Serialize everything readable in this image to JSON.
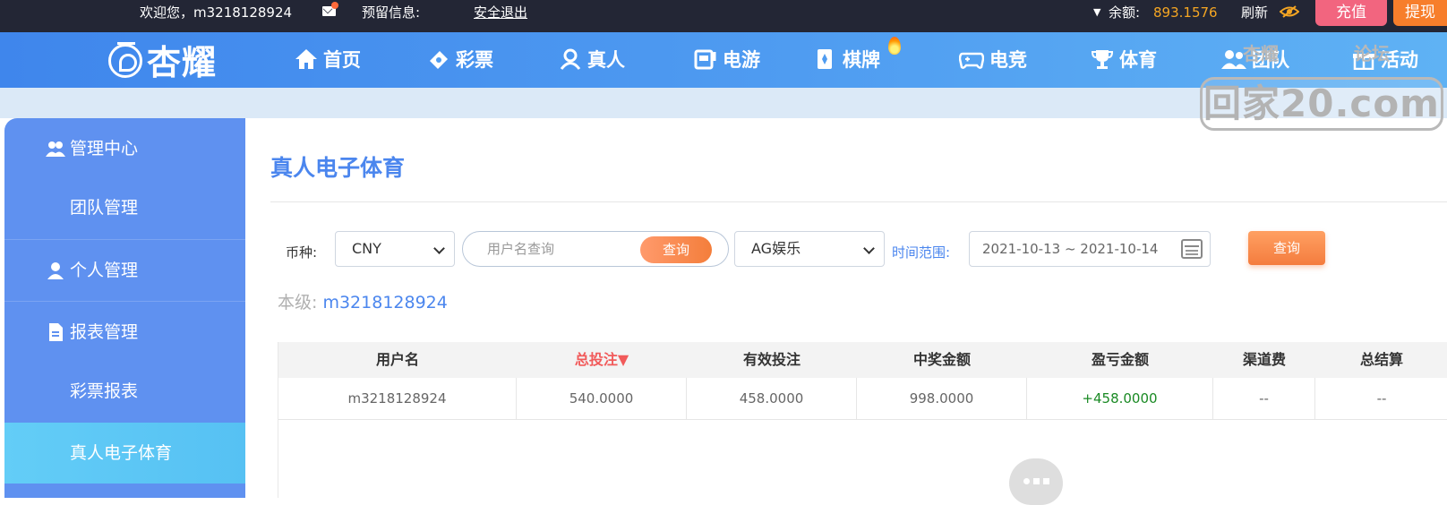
{
  "topbar": {
    "welcome": "欢迎您，m3218128924",
    "reserved_info": "预留信息:",
    "logout": "安全退出",
    "balance_label": "余额:",
    "balance_value": "893.1576",
    "refresh": "刷新",
    "recharge": "充值",
    "withdraw": "提现",
    "icons": [
      "mail-icon",
      "chevron-down-icon",
      "eye-slash-icon"
    ]
  },
  "brand": {
    "logo_text": "杏耀"
  },
  "nav": {
    "items": [
      {
        "label": "首页",
        "icon": "home-icon"
      },
      {
        "label": "彩票",
        "icon": "ticket-icon"
      },
      {
        "label": "真人",
        "icon": "live-dealer-icon"
      },
      {
        "label": "电游",
        "icon": "slot-machine-icon"
      },
      {
        "label": "棋牌",
        "icon": "cards-icon"
      },
      {
        "label": "电竞",
        "icon": "gamepad-icon"
      },
      {
        "label": "体育",
        "icon": "trophy-icon"
      },
      {
        "label": "团队",
        "icon": "team-icon"
      },
      {
        "label": "活动",
        "icon": "gift-icon"
      }
    ]
  },
  "watermark": {
    "text": "回家20.com"
  },
  "sidebar": {
    "items": [
      {
        "label": "管理中心",
        "icon": "team-icon"
      },
      {
        "label": "团队管理"
      },
      {
        "label": "个人管理",
        "icon": "user-icon"
      },
      {
        "label": "报表管理",
        "icon": "report-icon"
      },
      {
        "label": "彩票报表"
      },
      {
        "label": "真人电子体育"
      }
    ]
  },
  "main": {
    "title": "真人电子体育",
    "filters": {
      "currency_label": "币种:",
      "currency_value": "CNY",
      "username_placeholder": "用户名查询",
      "search_btn": "查询",
      "platform_value": "AG娱乐",
      "time_label": "时间范围:",
      "date_range": "2021-10-13 ~ 2021-10-14",
      "query_btn": "查询"
    },
    "level_label": "本级:",
    "level_value": "m3218128924",
    "table": {
      "headers": [
        "用户名",
        "总投注▼",
        "有效投注",
        "中奖金额",
        "盈亏金额",
        "渠道费",
        "总结算"
      ],
      "rows": [
        [
          "m3218128924",
          "540.0000",
          "458.0000",
          "998.0000",
          "+458.0000",
          "--",
          "--"
        ]
      ]
    }
  },
  "colors": {
    "topbar_bg": "#232635",
    "nav_blue": "#4f9cf1",
    "sidebar_bg": "#5f91f0",
    "sidebar_active": "#56c1f3",
    "accent_orange": "#f47c3e",
    "title_blue": "#4b86ee",
    "sort_red": "#f15a5a",
    "profit_green": "#1a8a24"
  }
}
